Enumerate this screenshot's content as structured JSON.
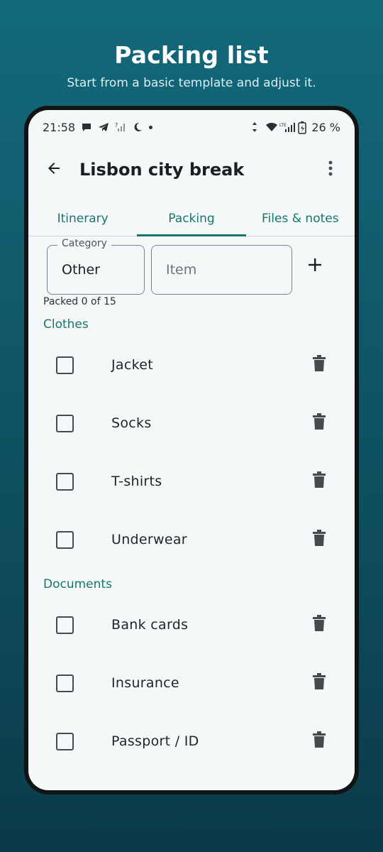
{
  "promo": {
    "title": "Packing list",
    "subtitle": "Start from a basic template and adjust it."
  },
  "status_bar": {
    "time": "21:58",
    "battery": "26 %",
    "network": "LTE",
    "left_icons": [
      "chat-bubble-icon",
      "telegram-icon",
      "no-signal-icon",
      "moon-icon",
      "dot-icon"
    ],
    "right_icons": [
      "data-arrows-icon",
      "wifi-icon",
      "lte-signal-icon",
      "battery-charging-icon"
    ]
  },
  "app_bar": {
    "title": "Lisbon city break",
    "back_icon": "arrow-left-icon",
    "menu_icon": "more-vert-icon"
  },
  "tabs": [
    {
      "label": "Itinerary",
      "active": false
    },
    {
      "label": "Packing",
      "active": true
    },
    {
      "label": "Files & notes",
      "active": false
    }
  ],
  "add_form": {
    "category_label": "Category",
    "category_value": "Other",
    "item_placeholder": "Item",
    "add_icon": "plus-icon"
  },
  "packed_summary": "Packed 0 of 15",
  "sections": [
    {
      "title": "Clothes",
      "items": [
        {
          "label": "Jacket",
          "checked": false
        },
        {
          "label": "Socks",
          "checked": false
        },
        {
          "label": "T-shirts",
          "checked": false
        },
        {
          "label": "Underwear",
          "checked": false
        }
      ]
    },
    {
      "title": "Documents",
      "items": [
        {
          "label": "Bank cards",
          "checked": false
        },
        {
          "label": "Insurance",
          "checked": false
        },
        {
          "label": "Passport / ID",
          "checked": false
        }
      ]
    }
  ],
  "colors": {
    "accent": "#18756b",
    "screen_background": "#f4f8f8",
    "backdrop_top": "#13697a",
    "backdrop_bottom": "#0b3a49",
    "icon_dark": "#434b4d"
  }
}
